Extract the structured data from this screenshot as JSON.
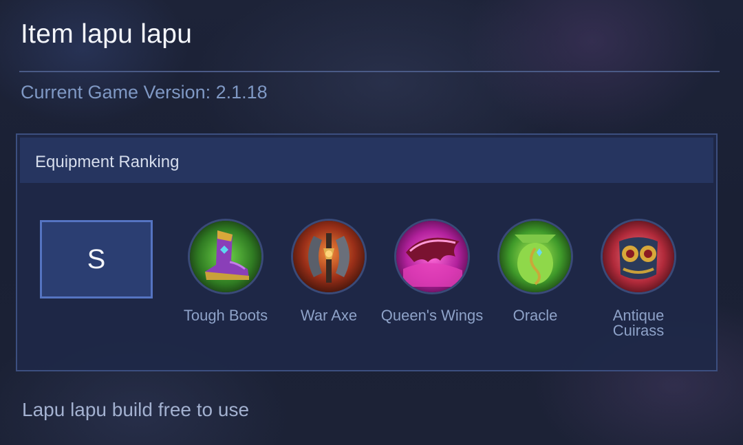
{
  "header": {
    "title": "Item lapu lapu",
    "version_text": "Current Game Version: 2.1.18"
  },
  "ranking_panel": {
    "heading": "Equipment Ranking",
    "tier": "S",
    "items": [
      {
        "name": "Tough Boots",
        "icon": "tough-boots-icon"
      },
      {
        "name": "War Axe",
        "icon": "war-axe-icon"
      },
      {
        "name": "Queen's Wings",
        "icon": "queens-wings-icon"
      },
      {
        "name": "Oracle",
        "icon": "oracle-icon"
      },
      {
        "name": "Antique Cuirass",
        "icon": "antique-cuirass-icon"
      }
    ]
  },
  "footer": {
    "text": "Lapu lapu build free to use"
  },
  "colors": {
    "background": "#1b2136",
    "panel": "#1e2848",
    "panel_header": "#263560",
    "tier_box": "#2b3e72",
    "tier_border": "#5574c2",
    "divider": "#4a5a86",
    "version_text": "#7f98c4",
    "item_label": "#8ea2c8"
  }
}
